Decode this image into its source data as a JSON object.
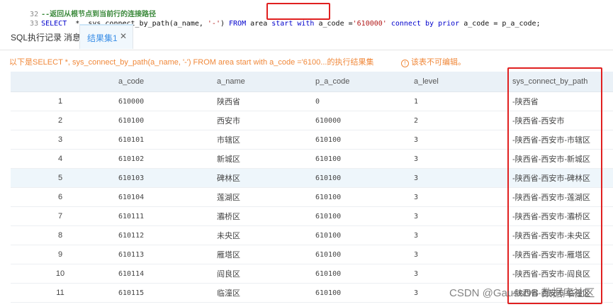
{
  "editor": {
    "line1": {
      "number": "32",
      "text": "--返回从根节点到当前行的连接路径"
    },
    "line2": {
      "number": "33",
      "parts": [
        {
          "t": "SELECT",
          "c": "kw"
        },
        {
          "t": "  *, sys_connect_by_path(a_name, ",
          "c": "plain"
        },
        {
          "t": "'-'",
          "c": "str"
        },
        {
          "t": ") ",
          "c": "plain"
        },
        {
          "t": "FROM",
          "c": "kw"
        },
        {
          "t": " area ",
          "c": "plain"
        },
        {
          "t": "start with",
          "c": "kw"
        },
        {
          "t": " a_code =",
          "c": "plain"
        },
        {
          "t": "'610000'",
          "c": "str"
        },
        {
          "t": " ",
          "c": "plain"
        },
        {
          "t": "connect by prior",
          "c": "kw"
        },
        {
          "t": " a_code = p_a_code;",
          "c": "plain"
        }
      ]
    }
  },
  "tabs": {
    "sql_history": "SQL执行记录",
    "messages": "消息",
    "result": "结果集1",
    "close": "✕"
  },
  "info": {
    "message": "以下是SELECT *, sys_connect_by_path(a_name, '-') FROM area start with a_code ='6100...的执行结果集",
    "warning": "该表不可编辑。",
    "warning_icon": "!"
  },
  "table": {
    "columns": [
      "",
      "a_code",
      "a_name",
      "p_a_code",
      "a_level",
      "sys_connect_by_path"
    ],
    "rows": [
      [
        "1",
        "610000",
        "陕西省",
        "0",
        "1",
        "-陕西省"
      ],
      [
        "2",
        "610100",
        "西安市",
        "610000",
        "2",
        "-陕西省-西安市"
      ],
      [
        "3",
        "610101",
        "市辖区",
        "610100",
        "3",
        "-陕西省-西安市-市辖区"
      ],
      [
        "4",
        "610102",
        "新城区",
        "610100",
        "3",
        "-陕西省-西安市-新城区"
      ],
      [
        "5",
        "610103",
        "碑林区",
        "610100",
        "3",
        "-陕西省-西安市-碑林区"
      ],
      [
        "6",
        "610104",
        "莲湖区",
        "610100",
        "3",
        "-陕西省-西安市-莲湖区"
      ],
      [
        "7",
        "610111",
        "灞桥区",
        "610100",
        "3",
        "-陕西省-西安市-灞桥区"
      ],
      [
        "8",
        "610112",
        "未央区",
        "610100",
        "3",
        "-陕西省-西安市-未央区"
      ],
      [
        "9",
        "610113",
        "雁塔区",
        "610100",
        "3",
        "-陕西省-西安市-雁塔区"
      ],
      [
        "10",
        "610114",
        "阎良区",
        "610100",
        "3",
        "-陕西省-西安市-阎良区"
      ],
      [
        "11",
        "610115",
        "临潼区",
        "610100",
        "3",
        "-陕西省-西安市-临潼区"
      ]
    ],
    "selected_row": 4
  },
  "watermark": "CSDN @GaussDB 数据库社区"
}
